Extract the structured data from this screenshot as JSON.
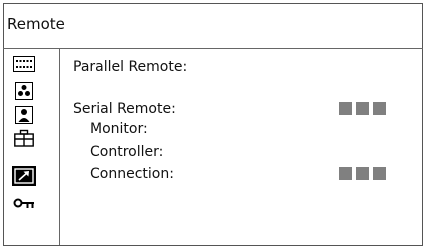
{
  "title": "Remote",
  "sidebar": {
    "icons": [
      "menu-list-icon",
      "color-circles-icon",
      "person-icon",
      "briefcase-icon",
      "maintenance-arrow-icon",
      "key-icon"
    ],
    "selected": "maintenance-arrow-icon"
  },
  "settings": {
    "parallel_remote_label": "Parallel Remote:",
    "serial_remote_label": "Serial Remote:",
    "monitor_label": "Monitor:",
    "controller_label": "Controller:",
    "connection_label": "Connection:"
  },
  "colors": {
    "selected_icon_bg": "#000000",
    "value_block": "#808080",
    "border": "#555555"
  }
}
